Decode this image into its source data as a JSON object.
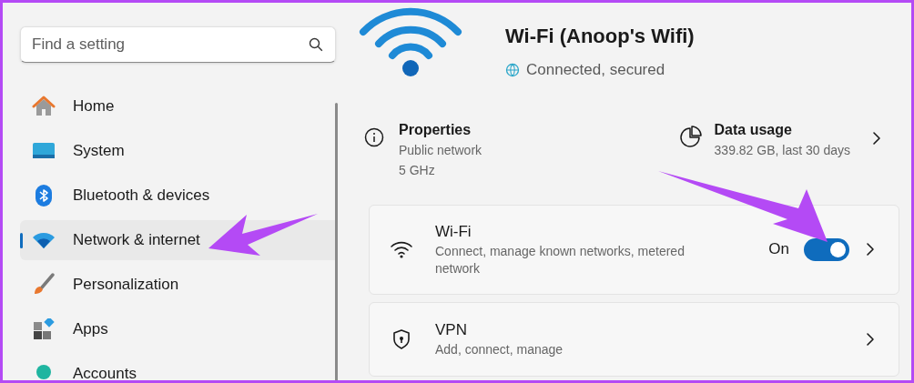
{
  "search": {
    "placeholder": "Find a setting"
  },
  "nav": [
    {
      "label": "Home",
      "selected": false
    },
    {
      "label": "System",
      "selected": false
    },
    {
      "label": "Bluetooth & devices",
      "selected": false
    },
    {
      "label": "Network & internet",
      "selected": true
    },
    {
      "label": "Personalization",
      "selected": false
    },
    {
      "label": "Apps",
      "selected": false
    },
    {
      "label": "Accounts",
      "selected": false
    }
  ],
  "header": {
    "title": "Wi-Fi (Anoop's Wifi)",
    "status": "Connected, secured"
  },
  "properties": {
    "title": "Properties",
    "lines": [
      "Public network",
      "5 GHz"
    ]
  },
  "data_usage": {
    "title": "Data usage",
    "detail": "339.82 GB, last 30 days"
  },
  "cards": [
    {
      "kind": "toggle",
      "title": "Wi-Fi",
      "subtitle": "Connect, manage known networks, metered network",
      "state_label": "On",
      "on": true
    },
    {
      "kind": "link",
      "title": "VPN",
      "subtitle": "Add, connect, manage"
    }
  ]
}
